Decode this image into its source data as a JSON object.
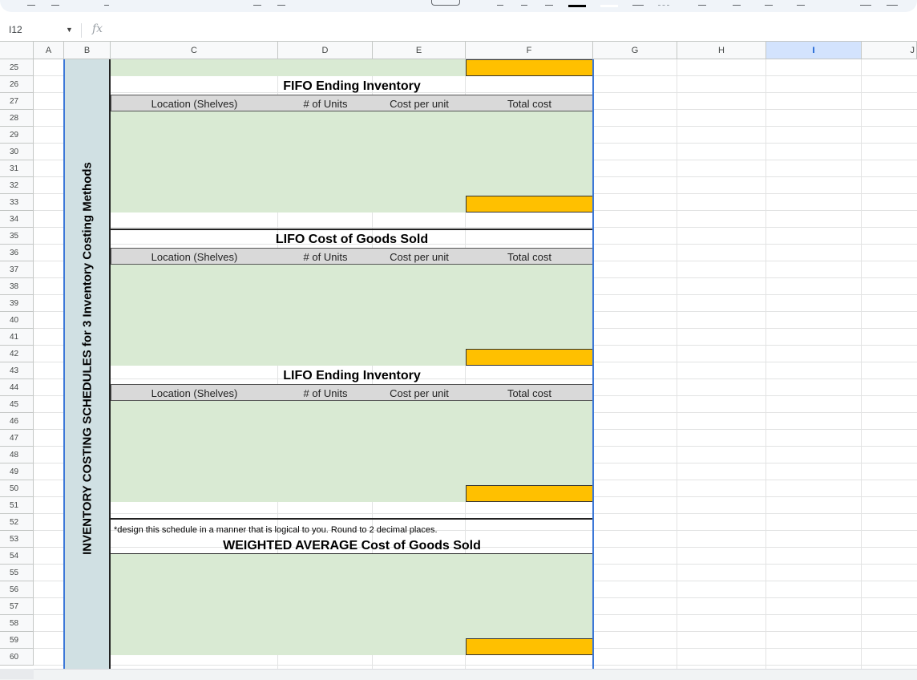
{
  "name_box": "I12",
  "fx_label": "fx",
  "columns": [
    {
      "label": "A",
      "selected": false
    },
    {
      "label": "B",
      "selected": false
    },
    {
      "label": "C",
      "selected": false
    },
    {
      "label": "D",
      "selected": false
    },
    {
      "label": "E",
      "selected": false
    },
    {
      "label": "F",
      "selected": false
    },
    {
      "label": "G",
      "selected": false
    },
    {
      "label": "H",
      "selected": false
    },
    {
      "label": "I",
      "selected": true
    },
    {
      "label": "J",
      "selected": false
    }
  ],
  "rows": [
    "25",
    "26",
    "27",
    "28",
    "29",
    "30",
    "31",
    "32",
    "33",
    "34",
    "35",
    "36",
    "37",
    "38",
    "39",
    "40",
    "41",
    "42",
    "43",
    "44",
    "45",
    "46",
    "47",
    "48",
    "49",
    "50",
    "51",
    "52",
    "53",
    "54",
    "55",
    "56",
    "57",
    "58",
    "59",
    "60"
  ],
  "side_label": "INVENTORY COSTING SCHEDULES for 3 Inventory Costing Methods",
  "sections": [
    {
      "title": "FIFO Ending Inventory",
      "headers": [
        "Location (Shelves)",
        "# of Units",
        "Cost per unit",
        "Total cost"
      ]
    },
    {
      "title": "LIFO Cost of Goods Sold",
      "headers": [
        "Location (Shelves)",
        "# of Units",
        "Cost per unit",
        "Total cost"
      ]
    },
    {
      "title": "LIFO Ending Inventory",
      "headers": [
        "Location (Shelves)",
        "# of Units",
        "Cost per unit",
        "Total cost"
      ]
    }
  ],
  "note": "*design this schedule in a manner that is logical to you. Round to 2 decimal places.",
  "weighted_title": "WEIGHTED AVERAGE Cost of Goods Sold",
  "colors": {
    "input_green": "#d9ead3",
    "total_orange": "#ffc000",
    "side_band": "#d0e0e3",
    "header_gray": "#d9d9d9",
    "selection_blue": "#3c78d8"
  }
}
